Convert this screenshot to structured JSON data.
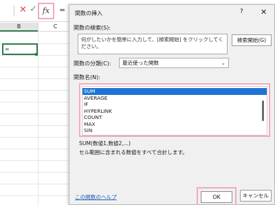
{
  "formula_bar": {
    "cancel_icon": "cross-icon",
    "enter_icon": "check-icon",
    "fx_label": "fx",
    "formula_text": "="
  },
  "columns": [
    "B",
    "C"
  ],
  "active_cell": {
    "value": "="
  },
  "dialog": {
    "title": "関数の挿入",
    "help": "?",
    "close": "✕",
    "search_label": "関数の検索(S):",
    "search_placeholder": "何がしたいかを簡単に入力して、[検索開始] をクリックしてください。",
    "search_button": "検索開始(G)",
    "category_label": "関数の分類(C):",
    "category_value": "最近使った関数",
    "function_label": "関数名(N):",
    "functions": [
      "SUM",
      "AVERAGE",
      "IF",
      "HYPERLINK",
      "COUNT",
      "MAX",
      "SIN"
    ],
    "selected_function": "SUM",
    "signature": "SUM(数値1,数値2,...)",
    "description": "セル範囲に含まれる数値をすべて合計します。",
    "help_link": "この関数のヘルプ",
    "ok_button": "OK",
    "cancel_button": "キャンセル"
  },
  "colors": {
    "highlight": "#f4a7c2",
    "selection": "#1e73d6",
    "excel_green": "#2a7b4b"
  }
}
